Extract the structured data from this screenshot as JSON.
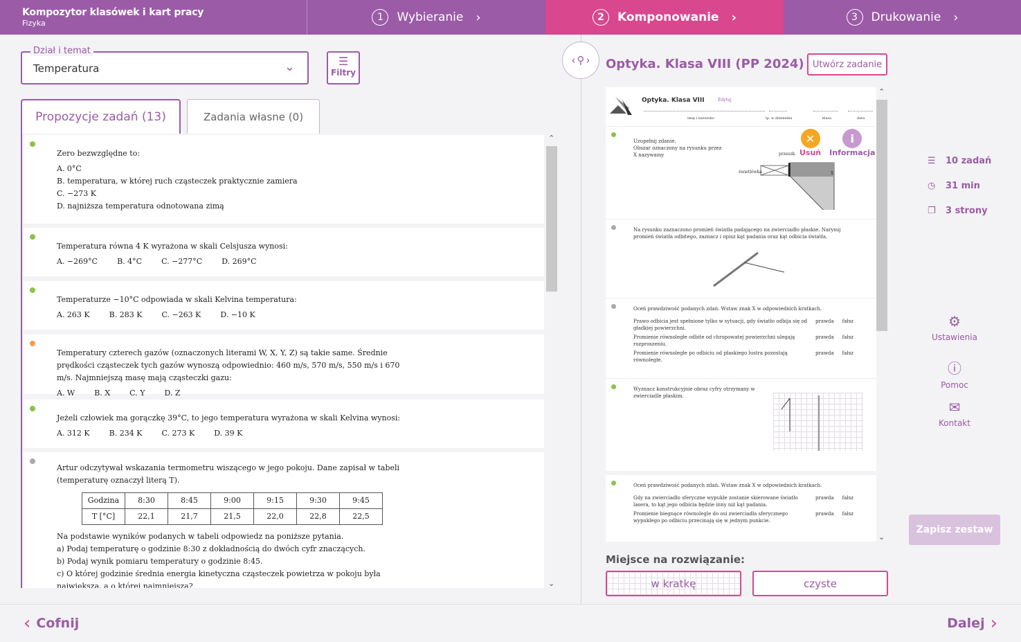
{
  "app": {
    "title": "Kompozytor klasówek i kart pracy",
    "subject": "Fizyka"
  },
  "steps": [
    {
      "num": "1",
      "label": "Wybieranie"
    },
    {
      "num": "2",
      "label": "Komponowanie"
    },
    {
      "num": "3",
      "label": "Drukowanie"
    }
  ],
  "filter": {
    "label": "Dział i temat",
    "value": "Temperatura",
    "button": "Filtry"
  },
  "tabs": {
    "proposals": "Propozycje zadań (13)",
    "own": "Zadania własne (0)"
  },
  "tasks": [
    {
      "q": "Zero bezwzględne to:",
      "options": [
        "A. 0°C",
        "B. temperatura, w której ruch cząsteczek praktycznie zamiera",
        "C. −273 K",
        "D. najniższa temperatura odnotowana zimą"
      ]
    },
    {
      "q": "Temperatura równa 4 K wyrażona w skali Celsjusza wynosi:",
      "options": [
        "A. −269°C",
        "B. 4°C",
        "C. −277°C",
        "D. 269°C"
      ]
    },
    {
      "q": "Temperaturze −10°C odpowiada w skali Kelvina temperatura:",
      "options": [
        "A. 263 K",
        "B. 283 K",
        "C. −263 K",
        "D. −10 K"
      ]
    },
    {
      "q": "Temperatury czterech gazów (oznaczonych literami W, X, Y, Z) są takie same. Średnie prędkości cząsteczek tych gazów wynoszą odpowiednio: 460 m/s, 570 m/s, 550 m/s i 670 m/s. Najmniejszą masę mają cząsteczki gazu:",
      "options": [
        "A. W",
        "B. X",
        "C. Y",
        "D. Z"
      ]
    },
    {
      "q": "Jeżeli człowiek ma gorączkę 39°C, to jego temperatura wyrażona w skali Kelvina wynosi:",
      "options": [
        "A. 312 K",
        "B. 234 K",
        "C. 273 K",
        "D. 39 K"
      ]
    },
    {
      "q": "Artur odczytywał wskazania termometru wiszącego w jego pokoju. Dane zapisał w tabeli (temperaturę oznaczył literą T).",
      "table": {
        "h1": "Godzina",
        "times": [
          "8:30",
          "8:45",
          "9:00",
          "9:15",
          "9:30",
          "9:45"
        ],
        "h2": "T [°C]",
        "temps": [
          "22,1",
          "21,7",
          "21,5",
          "22,0",
          "22,8",
          "22,5"
        ]
      },
      "after": [
        "Na podstawie wyników podanych w tabeli odpowiedz na poniższe pytania.",
        "a)  Podaj temperaturę o godzinie 8:30 z dokładnością do dwóch cyfr znaczących.",
        "b)  Podaj wynik pomiaru temperatury o godzinie 8:45.",
        "c)  O której godzinie średnia energia kinetyczna cząsteczek powietrza w pokoju była największa, a o której najmniejsza?"
      ]
    }
  ],
  "preview": {
    "title": "Optyka. Klasa VIII (PP 2024)",
    "create": "Utwórz zadanie",
    "sheet_title": "Optyka. Klasa VIII",
    "edit": "Edytuj",
    "fields": [
      "imię i nazwisko",
      "lp. w dzienniku",
      "klasa",
      "data"
    ],
    "actions": {
      "remove": "Usuń",
      "info": "Informacja"
    },
    "p1": [
      "Uzupełnij zdanie.",
      "Obszar oznaczony na rysunku przez X nazywamy"
    ],
    "p1labels": {
      "a": "przeszk.",
      "b": "świetlówka",
      "c": "X"
    },
    "p2": "Na rysunku zaznaczono promień światła padającego na zwierciadło płaskie. Narysuj promień światła odbitego, zaznacz i opisz kąt padania oraz kąt odbicia światła.",
    "p3": {
      "q": "Oceń prawdziwość podanych zdań. Wstaw znak X w odpowiednich kratkach.",
      "rows": [
        "Prawo odbicia jest spełnione tylko w sytuacji, gdy światło odbija się od gładkiej powierzchni.",
        "Promienie równoległe odbite od chropowatej powierzchni ulegają rozproszeniu.",
        "Promienie równoległe po odbiciu od płaskiego lustra pozostają równoległe."
      ],
      "t": "prawda",
      "f": "fałsz"
    },
    "p4": "Wyznacz konstrukcyjnie obraz cyfry otrzymany w zwierciadle płaskim.",
    "p5": {
      "q": "Oceń prawdziwość podanych zdań. Wstaw znak X w odpowiednich kratkach.",
      "rows": [
        "Gdy na zwierciadło sferyczne wypukłe zostanie skierowane światło lasera, to kąt jego odbicia będzie inny niż kąt padania.",
        "Promienie biegnące równolegle do osi zwierciadła sferycznego wypukłego po odbiciu przecinają się w jednym punkcie."
      ]
    }
  },
  "place": {
    "label": "Miejsce na rozwiązanie:",
    "grid": "w kratkę",
    "clean": "czyste"
  },
  "stats": {
    "tasks": "10 zadań",
    "time": "31 min",
    "pages": "3 strony"
  },
  "side": {
    "settings": "Ustawienia",
    "help": "Pomoc",
    "contact": "Kontakt",
    "save": "Zapisz zestaw"
  },
  "nav": {
    "back": "Cofnij",
    "next": "Dalej"
  },
  "colors": {
    "brand": "#9b5ba6",
    "accent": "#d9478f"
  }
}
